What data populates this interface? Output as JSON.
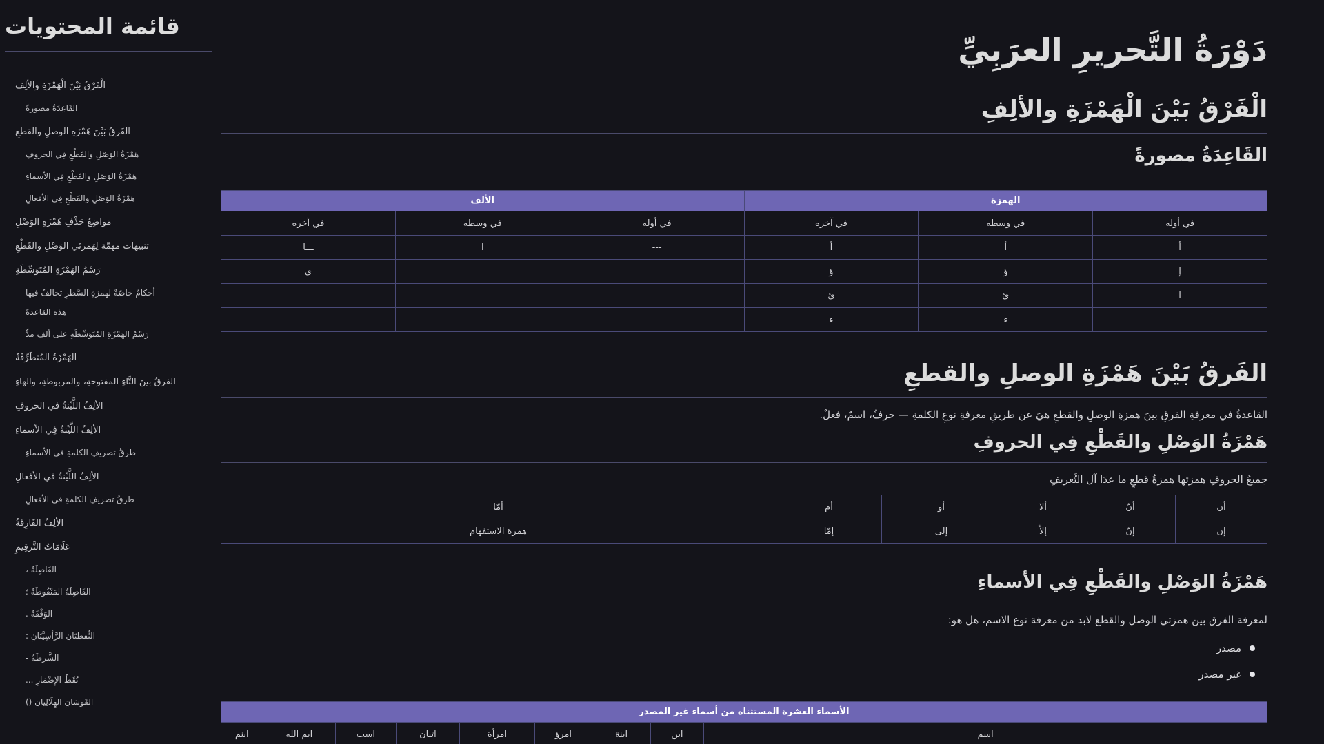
{
  "page_title": "دَوْرَةُ التَّحريرِ العرَبِيِّ",
  "toc": {
    "title": "قائمة المحتويات",
    "items": [
      {
        "label": "الْفَرْقُ بَيْنَ الْهَمْزَةِ والألِف",
        "level": 1
      },
      {
        "label": "القَاعِدَةُ مصورةً",
        "level": 2
      },
      {
        "label": "الفَرقُ بَيْنَ هَمْزَةِ الوصلِ والقطعِ",
        "level": 1
      },
      {
        "label": "هَمْزَةُ الوَصْلِ والقَطْعِ فِي الحروفِ",
        "level": 2
      },
      {
        "label": "هَمْزَةُ الوَصْلِ والقَطْعِ فِي الأسماءِ",
        "level": 2
      },
      {
        "label": "هَمْزَةُ الوَصْلِ والقَطْعِ فِي الأفعالِ",
        "level": 2
      },
      {
        "label": "مَواضِعُ حَذْفِ هَمْزَةِ الوَصْلِ",
        "level": 1
      },
      {
        "label": "تنبيهات مهمّة لِهَمزتَي الوَصْلِ والقَطْعِ",
        "level": 1
      },
      {
        "label": "رَسْمُ الهَمْزَةِ المُتَوَسِّطَةِ",
        "level": 1
      },
      {
        "label": "أحكامٌ خاصّةٌ لهمزةِ السَّطرِ تخالفُ فيها",
        "level": 2
      },
      {
        "label": "هذه القاعدةَ",
        "level": 2
      },
      {
        "label": "رَسْمُ الهَمْزَةِ المُتَوَسِّطَةِ على ألف مدٍّ",
        "level": 2
      },
      {
        "label": "الهَمْزَةُ المُتَطَرِّفَةُ",
        "level": 1
      },
      {
        "label": "الفرقُ بينَ التَّاءِ المفتوحةِ، والمربوطةِ، والهاءِ",
        "level": 1
      },
      {
        "label": "الألِفُ اللَّيِّنةُ في الحروفِ",
        "level": 1
      },
      {
        "label": "الألِفُ اللَّيِّنةُ فِي الأسماءِ",
        "level": 1
      },
      {
        "label": "طرقُ تصريفِ الكلمةِ في الأسماءِ",
        "level": 2
      },
      {
        "label": "الألِفُ اللَّيِّنةُ في الأفعالِ",
        "level": 1
      },
      {
        "label": "طرقُ تصريفِ الكلمةِ في الأفعالِ",
        "level": 2
      },
      {
        "label": "الألِفُ الفَارِقَةُ",
        "level": 1
      },
      {
        "label": "عَلَامَاتُ التَّرقِيمِ",
        "level": 1
      },
      {
        "label": "الفَاصِلَةُ ،",
        "level": 2
      },
      {
        "label": "الفَاصِلَةُ المَنْقُوطَةُ ؛",
        "level": 2
      },
      {
        "label": "الوَقْفَةُ .",
        "level": 2
      },
      {
        "label": "النُّقطتَانِ الرَّأسِيَّتَانِ :",
        "level": 2
      },
      {
        "label": "الشَّرطَةُ -",
        "level": 2
      },
      {
        "label": "نُقَطُ الإِضْمَارِ ...",
        "level": 2
      },
      {
        "label": "القَوسَانِ الهِلَالِيانِ ()",
        "level": 2
      }
    ]
  },
  "sections": {
    "s1_title": "الْفَرْقُ بَيْنَ الْهَمْزَةِ والألِفِ",
    "s1_sub_title": "القَاعِدَةُ مصورةً",
    "hamza_table": {
      "band_hamza": "الهمزة",
      "band_alif": "الألف",
      "sub_headers": [
        "في أوله",
        "في وسطه",
        "في آخره",
        "في أوله",
        "في وسطه",
        "في آخره"
      ],
      "rows": [
        [
          "أ",
          "أ",
          "أ",
          "---",
          "ا",
          "ـــا"
        ],
        [
          "إ",
          "ؤ",
          "ؤ",
          "",
          "",
          "ى"
        ],
        [
          "ا",
          "ئ",
          "ئ",
          "",
          "",
          ""
        ],
        [
          "",
          "ء",
          "ء",
          "",
          "",
          ""
        ]
      ]
    },
    "s2_title": "الفَرقُ بَيْنَ هَمْزَةِ الوصلِ والقطعِ",
    "s2_para": "القاعدةُ في معرفةِ الفرقِ بينَ همزةِ الوصلِ والقطعِ هيَ عن طريقِ معرفةِ نوعِ الكلمةِ — حرفٌ، اسمٌ، فعلٌ.",
    "s2a_title": "هَمْزَةُ الوَصْلِ والقَطْعِ فِي الحروفِ",
    "s2a_para": "جميعُ الحروفِ همزتها همزةُ قطعٍ ما عدَا آل التَّعريفِ",
    "letters_table": {
      "rows": [
        [
          "أن",
          "أنّ",
          "ألا",
          "أو",
          "أم",
          "أمّا"
        ],
        [
          "إن",
          "إنّ",
          "إلاّ",
          "إلى",
          "إمّا",
          "همزة الاستفهام"
        ]
      ]
    },
    "s2b_title": "هَمْزَةُ الوَصْلِ والقَطْعِ فِي الأسماءِ",
    "s2b_para": "لمعرفة الفرق بين همزتي الوصل والقطع لابد من معرفة نوع الاسم، هل هو:",
    "s2b_bullets": [
      "مصدر",
      "غير مصدر"
    ],
    "names_table": {
      "band": "الأسماء العشرة المستثناه من أسماء غير المصدر",
      "row": [
        "اسم",
        "ابن",
        "ابنة",
        "امرؤ",
        "امرأة",
        "اثنان",
        "است",
        "ايم الله",
        "ابنم"
      ]
    }
  },
  "colors": {
    "background": "#14141a",
    "text": "#d8d8dc",
    "table_band": "#6e66b4",
    "table_border": "#4a4a78",
    "rule": "#4a4a6a"
  }
}
